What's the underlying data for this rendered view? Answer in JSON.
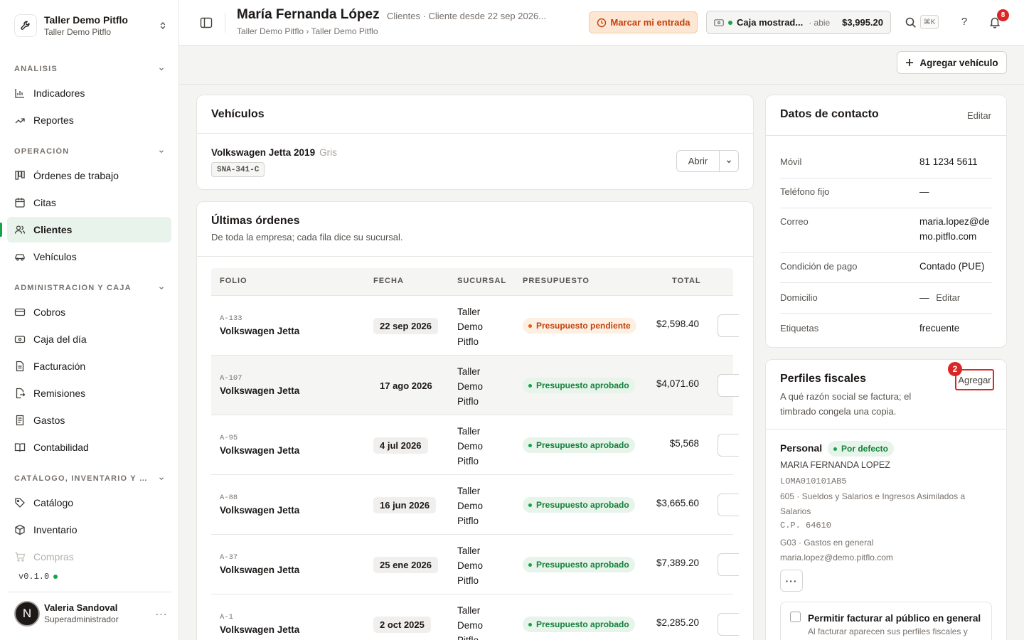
{
  "workspace": {
    "name": "Taller Demo Pitflo",
    "sub": "Taller Demo Pitflo"
  },
  "nav": {
    "groups": {
      "analisis": "ANÁLISIS",
      "operacion": "OPERACIÓN",
      "admin": "ADMINISTRACIÓN Y CAJA",
      "catalogo": "CATÁLOGO, INVENTARIO Y CO..."
    },
    "items": {
      "indicadores": "Indicadores",
      "reportes": "Reportes",
      "ordenes": "Órdenes de trabajo",
      "citas": "Citas",
      "clientes": "Clientes",
      "vehiculos": "Vehículos",
      "cobros": "Cobros",
      "caja": "Caja del día",
      "facturacion": "Facturación",
      "remisiones": "Remisiones",
      "gastos": "Gastos",
      "contabilidad": "Contabilidad",
      "catalogo": "Catálogo",
      "inventario": "Inventario",
      "compras": "Compras"
    },
    "active": "clientes"
  },
  "version": "v0.1.0",
  "user": {
    "name": "Valeria Sandoval",
    "role": "Superadministrador",
    "initial": "N"
  },
  "header": {
    "title": "María Fernanda López",
    "meta": "Clientes · Cliente desde 22 sep 2026...",
    "breadcrumb": "Taller Demo Pitflo › Taller Demo Pitflo",
    "entrada_label": "Marcar mi entrada",
    "caja_name": "Caja mostrad...",
    "caja_status": "· abie",
    "caja_amount": "$3,995.20",
    "search_kbd": "⌘K",
    "help": "?",
    "notif_count": "8"
  },
  "actions": {
    "add_vehicle": "Agregar vehículo"
  },
  "vehicles": {
    "title": "Vehículos",
    "items": [
      {
        "name": "Volkswagen Jetta 2019",
        "color": "Gris",
        "plate": "SNA-341-C",
        "open_label": "Abrir"
      }
    ]
  },
  "orders": {
    "title": "Últimas órdenes",
    "subtitle": "De toda la empresa; cada fila dice su sucursal.",
    "columns": [
      "FOLIO",
      "FECHA",
      "SUCURSAL",
      "PRESUPUESTO",
      "TOTAL"
    ],
    "rows": [
      {
        "folio": "A-133",
        "vehicle": "Volkswagen Jetta",
        "date": "22 sep 2026",
        "branch": "Taller Demo Pitflo",
        "status": "Presupuesto pendiente",
        "status_type": "pend",
        "total": "$2,598.40"
      },
      {
        "folio": "A-107",
        "vehicle": "Volkswagen Jetta",
        "date": "17 ago 2026",
        "branch": "Taller Demo Pitflo",
        "status": "Presupuesto aprobado",
        "status_type": "apr",
        "total": "$4,071.60"
      },
      {
        "folio": "A-95",
        "vehicle": "Volkswagen Jetta",
        "date": "4 jul 2026",
        "branch": "Taller Demo Pitflo",
        "status": "Presupuesto aprobado",
        "status_type": "apr",
        "total": "$5,568"
      },
      {
        "folio": "A-88",
        "vehicle": "Volkswagen Jetta",
        "date": "16 jun 2026",
        "branch": "Taller Demo Pitflo",
        "status": "Presupuesto aprobado",
        "status_type": "apr",
        "total": "$3,665.60"
      },
      {
        "folio": "A-37",
        "vehicle": "Volkswagen Jetta",
        "date": "25 ene 2026",
        "branch": "Taller Demo Pitflo",
        "status": "Presupuesto aprobado",
        "status_type": "apr",
        "total": "$7,389.20"
      },
      {
        "folio": "A-1",
        "vehicle": "Volkswagen Jetta",
        "date": "2 oct 2025",
        "branch": "Taller Demo Pitflo",
        "status": "Presupuesto aprobado",
        "status_type": "apr",
        "total": "$2,285.20"
      }
    ]
  },
  "contact": {
    "title": "Datos de contacto",
    "edit_label": "Editar",
    "fields": {
      "movil_label": "Móvil",
      "movil": "81 1234 5611",
      "fijo_label": "Teléfono fijo",
      "fijo": "—",
      "correo_label": "Correo",
      "correo": "maria.lopez@demo.pitflo.com",
      "pago_label": "Condición de pago",
      "pago": "Contado (PUE)",
      "domicilio_label": "Domicilio",
      "domicilio": "—",
      "domicilio_edit": "Editar",
      "etiquetas_label": "Etiquetas",
      "etiquetas": "frecuente"
    }
  },
  "fiscal": {
    "title": "Perfiles fiscales",
    "subtitle": "A qué razón social se factura; el timbrado congela una copia.",
    "add_label": "Agregar",
    "add_badge": "2",
    "profile": {
      "name": "Personal",
      "default_label": "Por defecto",
      "razon": "MARIA FERNANDA LOPEZ",
      "rfc": "LOMA010101AB5",
      "regimen": "605 · Sueldos y Salarios e Ingresos Asimilados a Salarios",
      "cp": "C.P. 64610",
      "uso": "G03 · Gastos en general",
      "email": "maria.lopez@demo.pitflo.com"
    },
    "publico_title": "Permitir facturar al público en general",
    "publico_desc": "Al facturar aparecen sus perfiles fiscales y"
  }
}
